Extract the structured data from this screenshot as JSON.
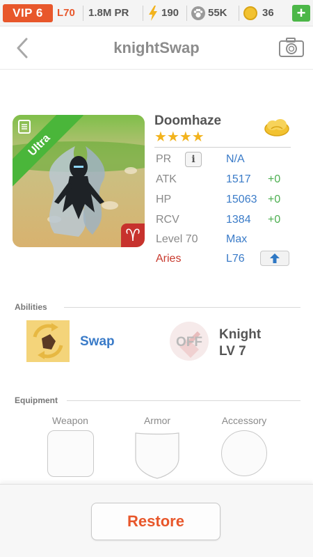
{
  "status_bar": {
    "vip": "VIP 6",
    "level": "L70",
    "pr": "1.8M PR",
    "energy": "190",
    "paw": "55K",
    "coins": "36",
    "plus": "+",
    "energy_icon": "lightning-icon",
    "paw_icon": "paw-icon",
    "coin_icon": "coin-icon"
  },
  "header": {
    "title": "knightSwap",
    "back_icon": "chevron-left-icon",
    "camera_icon": "camera-icon"
  },
  "monster": {
    "name": "Doomhaze",
    "stars": "★★★★",
    "rarity": "Ultra",
    "element_symbol": "♈",
    "stats": {
      "pr_label": "PR",
      "pr_value": "N/A",
      "info": "i",
      "atk_label": "ATK",
      "atk_value": "1517",
      "atk_bonus": "+0",
      "hp_label": "HP",
      "hp_value": "15063",
      "hp_bonus": "+0",
      "rcv_label": "RCV",
      "rcv_value": "1384",
      "rcv_bonus": "+0",
      "level_label": "Level 70",
      "level_value": "Max",
      "sign_label": "Aries",
      "sign_value": "L76"
    }
  },
  "abilities": {
    "title": "Abilities",
    "swap_label": "Swap",
    "off_label": "OFF",
    "knight_name": "Knight",
    "knight_level": "LV 7"
  },
  "equipment": {
    "title": "Equipment",
    "weapon": "Weapon",
    "armor": "Armor",
    "accessory": "Accessory"
  },
  "footer": {
    "restore": "Restore"
  },
  "colors": {
    "accent_orange": "#e8572b",
    "link_blue": "#3a7bc8",
    "bonus_green": "#4caf50",
    "ultra_green": "#4ab63a",
    "aries_red": "#c8392d",
    "star_gold": "#f2b31d"
  }
}
